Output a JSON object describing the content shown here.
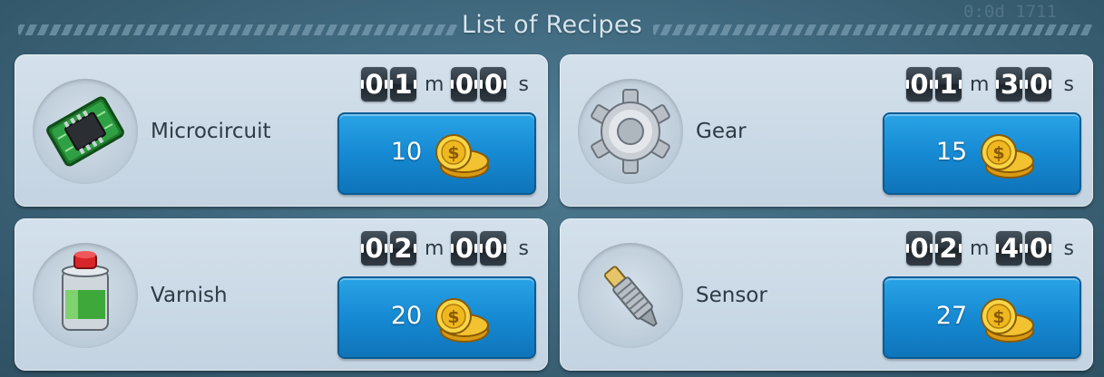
{
  "header": {
    "title": "List of Recipes",
    "corner_text": "0:0d 1711"
  },
  "units": {
    "minutes": "m",
    "seconds": "s"
  },
  "currency_icon": "gold-coins-icon",
  "colors": {
    "button": "#168ad3",
    "card": "#c9d8e5",
    "background": "#3d6479"
  },
  "recipes": [
    {
      "name": "Microcircuit",
      "icon": "microcircuit-icon",
      "time_digits": [
        "0",
        "1",
        "0",
        "0"
      ],
      "price": "10"
    },
    {
      "name": "Gear",
      "icon": "gear-icon",
      "time_digits": [
        "0",
        "1",
        "3",
        "0"
      ],
      "price": "15"
    },
    {
      "name": "Varnish",
      "icon": "varnish-can-icon",
      "time_digits": [
        "0",
        "2",
        "0",
        "0"
      ],
      "price": "20"
    },
    {
      "name": "Sensor",
      "icon": "sensor-icon",
      "time_digits": [
        "0",
        "2",
        "4",
        "0"
      ],
      "price": "27"
    }
  ]
}
